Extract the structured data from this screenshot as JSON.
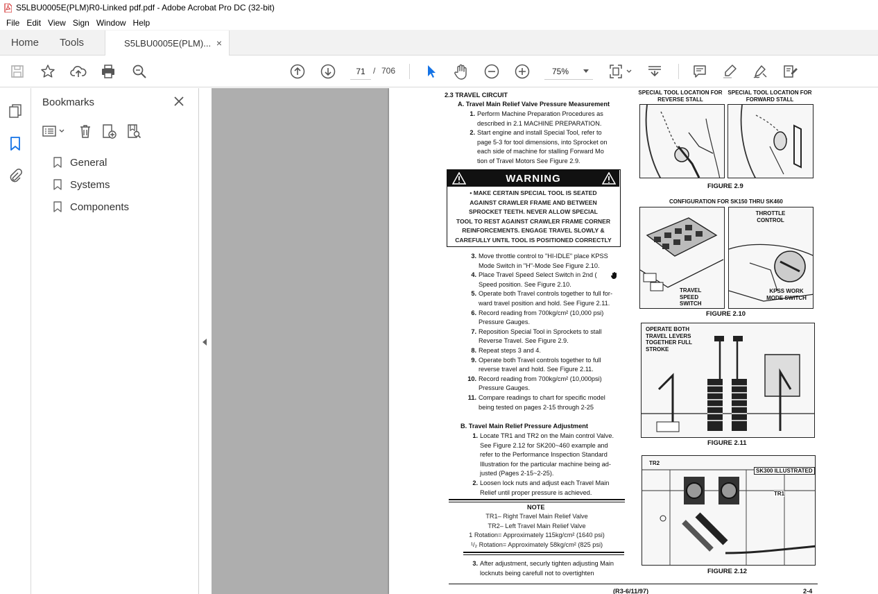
{
  "window": {
    "title": "S5LBU0005E(PLM)R0-Linked pdf.pdf - Adobe Acrobat Pro DC (32-bit)"
  },
  "menu": [
    "File",
    "Edit",
    "View",
    "Sign",
    "Window",
    "Help"
  ],
  "tabs": {
    "home": "Home",
    "tools": "Tools",
    "document": "S5LBU0005E(PLM)...",
    "close_glyph": "×"
  },
  "toolbar": {
    "page_current": "71",
    "page_separator": "/",
    "page_total": "706",
    "zoom": "75%"
  },
  "bookmarks": {
    "title": "Bookmarks",
    "items": [
      "General",
      "Systems",
      "Components"
    ]
  },
  "document": {
    "section_title": "2.3 TRAVEL CIRCUIT",
    "part_a_title": "A. Travel Main Relief Valve Pressure Measurement",
    "part_a_steps": [
      {
        "n": "1.",
        "lines": [
          "Perform Machine Preparation Procedures as",
          "described in 2.1 MACHINE PREPARATION."
        ]
      },
      {
        "n": "2.",
        "lines": [
          "Start engine and install Special Tool, refer to",
          "page 5-3 for tool dimensions, into Sprocket on",
          "each side of machine for stalling Forward Mo",
          "tion of Travel Motors  See Figure 2.9."
        ]
      }
    ],
    "warning_title": "WARNING",
    "warning_lines": [
      "• MAKE CERTAIN SPECIAL TOOL IS SEATED",
      "AGAINST CRAWLER FRAME AND BETWEEN",
      "SPROCKET TEETH. NEVER ALLOW SPECIAL",
      "TOOL TO REST AGAINST CRAWLER FRAME CORNER",
      "REINFORCEMENTS. ENGAGE TRAVEL SLOWLY &",
      "CAREFULLY UNTIL TOOL IS POSITIONED CORRECTLY"
    ],
    "part_a_steps_2": [
      {
        "n": "3.",
        "lines": [
          "Move throttle control to \"HI-IDLE\" place KPSS",
          "Mode Switch in \"H\"-Mode See Figure 2.10."
        ]
      },
      {
        "n": "4.",
        "lines": [
          "Place Travel Speed Select Switch in 2nd (",
          "Speed position. See Figure 2.10."
        ]
      },
      {
        "n": "5.",
        "lines": [
          "Operate both Travel controls together to full for-",
          "ward travel position and hold. See Figure 2.11."
        ]
      },
      {
        "n": "6.",
        "lines": [
          "Record reading from 700kg/cm² (10,000 psi)",
          "Pressure Gauges."
        ]
      },
      {
        "n": "7.",
        "lines": [
          "Reposition Special Tool in Sprockets to stall",
          "Reverse Travel. See Figure 2.9."
        ]
      },
      {
        "n": "8.",
        "lines": [
          "Repeat steps 3 and 4."
        ]
      },
      {
        "n": "9.",
        "lines": [
          "Operate both Travel controls together to full",
          "reverse travel and hold. See Figure 2.11."
        ]
      },
      {
        "n": "10.",
        "lines": [
          "Record reading from 700kg/cm² (10,000psi)",
          "Pressure Gauges."
        ]
      },
      {
        "n": "11.",
        "lines": [
          "Compare readings to chart for specific model",
          "being tested on pages 2-15 through 2-25"
        ]
      }
    ],
    "part_b_title": "B. Travel Main Relief Pressure Adjustment",
    "part_b_steps": [
      {
        "n": "1.",
        "lines": [
          "Locate TR1 and TR2 on the Main control Valve.",
          "See Figure 2.12 for SK200~460 example and",
          "refer to the Performance Inspection Standard",
          "Illustration for the particular machine being ad-",
          "justed (Pages 2-15~2-25)."
        ]
      },
      {
        "n": "2.",
        "lines": [
          "Loosen lock nuts and adjust each Travel Main",
          "Relief until proper pressure is achieved."
        ]
      }
    ],
    "note_title": "NOTE",
    "note_lines": [
      "TR1– Right Travel Main Relief Valve",
      "TR2– Left Travel Main Relief Valve",
      "1 Rotation= Approximately 115kg/cm² (1640 psi)",
      "¹/₂ Rotation= Approximately 58kg/cm² (825 psi)"
    ],
    "part_b_step_3": {
      "n": "3.",
      "lines": [
        "After adjustment, securly tighten adjusting Main",
        "locknuts being carefull not to overtighten"
      ]
    },
    "fig_labels": {
      "reverse": "SPECIAL TOOL LOCATION FOR REVERSE STALL",
      "forward": "SPECIAL TOOL LOCATION FOR FORWARD STALL",
      "fig29": "FIGURE 2.9",
      "config": "CONFIGURATION FOR SK150 THRU SK460",
      "throttle": "THROTTLE CONTROL",
      "travel_speed": "TRAVEL SPEED SWITCH",
      "kpss": "KPSS WORK MODE SWITCH",
      "fig210": "FIGURE 2.10",
      "operate_both": "OPERATE BOTH TRAVEL LEVERS TOGETHER FULL STROKE",
      "fig211": "FIGURE 2.11",
      "tr2": "TR2",
      "tr1": "TR1",
      "sk300": "SK300 ILLUSTRATED",
      "fig212": "FIGURE 2.12"
    },
    "footer_left": "(R3-6/11/97)",
    "footer_right": "2-4"
  }
}
